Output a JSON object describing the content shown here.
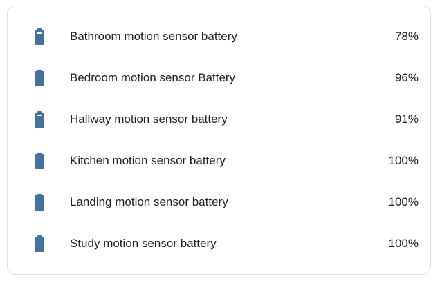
{
  "card": {
    "accent_color": "#44739e",
    "entities": [
      {
        "name": "Bathroom motion sensor battery",
        "state": "78%",
        "level": 78,
        "icon": "battery-80-icon"
      },
      {
        "name": "Bedroom motion sensor Battery",
        "state": "96%",
        "level": 96,
        "icon": "battery-full-icon"
      },
      {
        "name": "Hallway motion sensor battery",
        "state": "91%",
        "level": 91,
        "icon": "battery-90-icon"
      },
      {
        "name": "Kitchen motion sensor battery",
        "state": "100%",
        "level": 100,
        "icon": "battery-full-icon"
      },
      {
        "name": "Landing motion sensor battery",
        "state": "100%",
        "level": 100,
        "icon": "battery-full-icon"
      },
      {
        "name": "Study motion sensor battery",
        "state": "100%",
        "level": 100,
        "icon": "battery-full-icon"
      }
    ]
  }
}
